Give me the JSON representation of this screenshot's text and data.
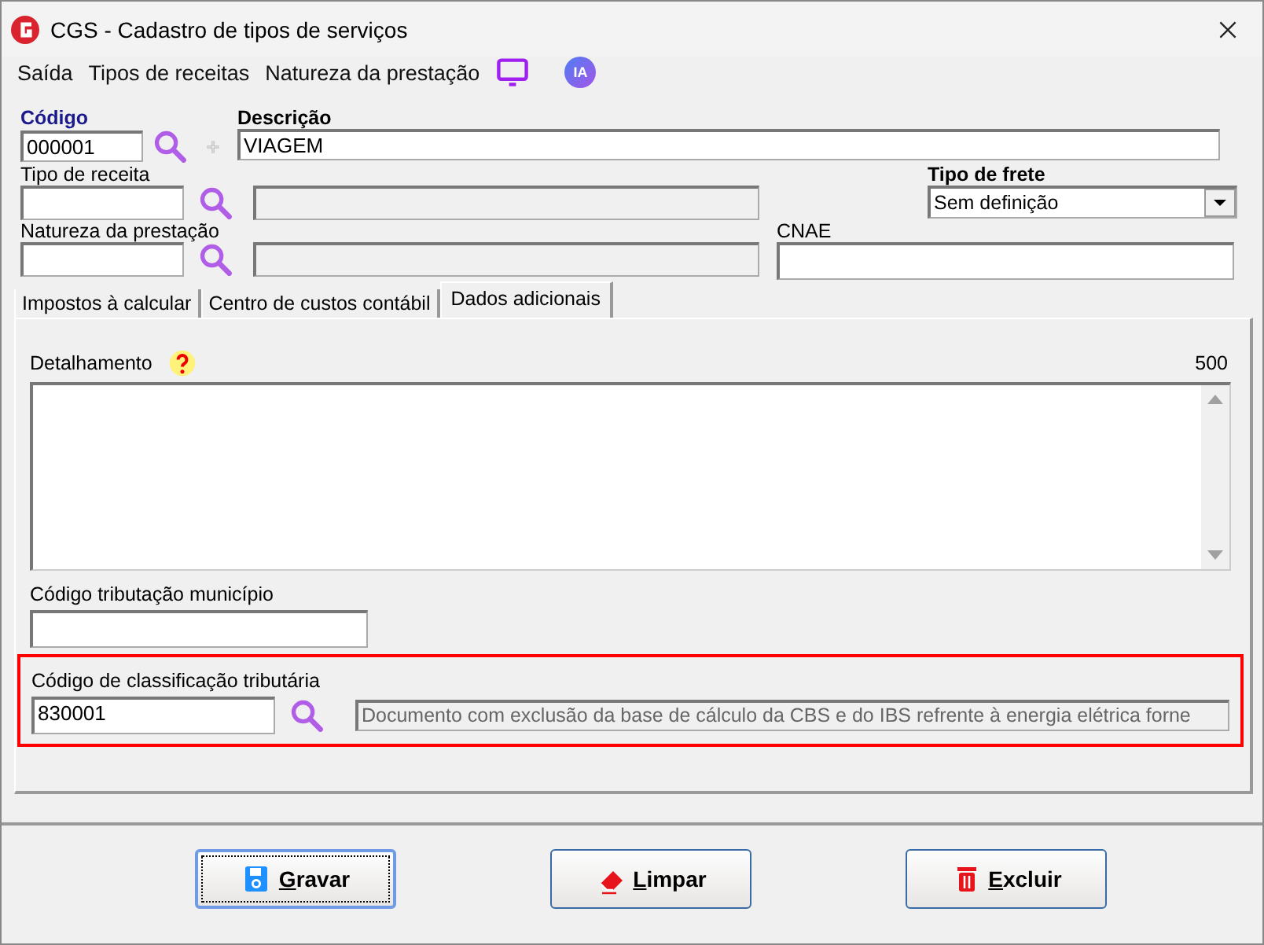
{
  "window": {
    "title": "CGS - Cadastro de tipos de serviços"
  },
  "menu": [
    {
      "label": "Saída"
    },
    {
      "label": "Tipos de receitas"
    },
    {
      "label": "Natureza da prestação"
    }
  ],
  "codigo": {
    "label": "Código",
    "value": "000001"
  },
  "descricao": {
    "label": "Descrição",
    "value": "VIAGEM"
  },
  "ai_badge": {
    "label": "IA"
  },
  "tipo_receita": {
    "label": "Tipo de receita",
    "name_disabled": true
  },
  "tipo_frete": {
    "label": "Tipo de frete",
    "value": "Sem definição"
  },
  "natureza": {
    "label": "Natureza da prestação",
    "name_disabled": true
  },
  "cnae": {
    "label": "CNAE"
  },
  "tabs": [
    {
      "label": "Impostos à calcular",
      "selected": false
    },
    {
      "label": "Centro de custos contábil",
      "selected": false
    },
    {
      "label": "Dados adicionais",
      "selected": true
    }
  ],
  "detalhamento": {
    "label": "Detalhamento",
    "counter": "500"
  },
  "tributacao_municipio": {
    "label": "Código tributação município"
  },
  "classificacao": {
    "label": "Código de classificação tributária",
    "value": "830001",
    "description": "Documento com exclusão da base de cálculo da CBS e do IBS refrente à energia elétrica forne",
    "highlighted": true
  },
  "buttons": [
    {
      "label": "Gravar",
      "kind": "save",
      "focused": true
    },
    {
      "label": "Limpar",
      "kind": "clear",
      "focused": false
    },
    {
      "label": "Excluir",
      "kind": "delete",
      "focused": false
    }
  ]
}
